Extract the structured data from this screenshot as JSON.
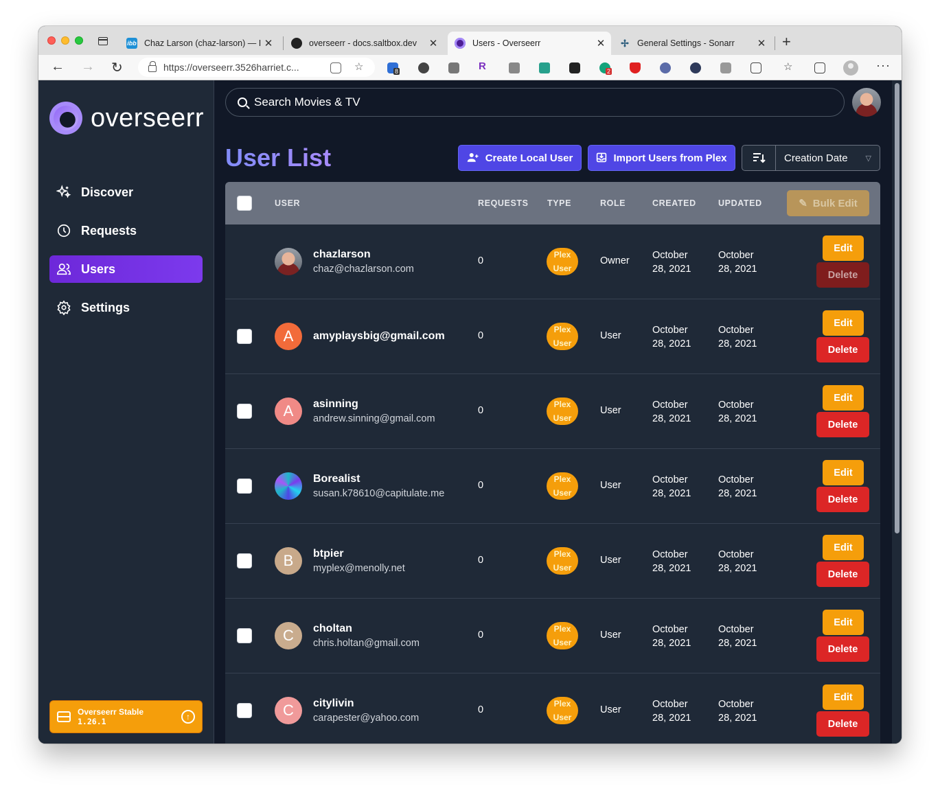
{
  "browser": {
    "tabs": [
      {
        "title": "Chaz Larson (chaz-larson) — I",
        "favicon": "ibb",
        "fav_color": "#1e90d6"
      },
      {
        "title": "overseerr - docs.saltbox.dev",
        "favicon": "github-icon",
        "fav_color": "#222222"
      },
      {
        "title": "Users - Overseerr",
        "favicon": "overseerr-icon",
        "fav_color": "#7c3aed",
        "active": true
      },
      {
        "title": "General Settings - Sonarr",
        "favicon": "sonarr-icon",
        "fav_color": "#2c5d7c"
      }
    ],
    "url": "https://overseerr.3526harriet.c...",
    "extension_badges": [
      "8",
      "2"
    ]
  },
  "app": {
    "logo_text": "overseerr",
    "nav": [
      {
        "label": "Discover",
        "icon": "sparkles-icon"
      },
      {
        "label": "Requests",
        "icon": "clock-icon"
      },
      {
        "label": "Users",
        "icon": "users-icon",
        "active": true
      },
      {
        "label": "Settings",
        "icon": "gear-icon"
      }
    ],
    "version": {
      "name": "Overseerr Stable",
      "number": "1.26.1"
    },
    "search_placeholder": "Search Movies & TV",
    "page_title": "User List",
    "buttons": {
      "create_local": "Create Local User",
      "import_plex": "Import Users from Plex",
      "sort_value": "Creation Date",
      "bulk_edit": "Bulk Edit",
      "edit": "Edit",
      "delete": "Delete"
    },
    "columns": [
      "USER",
      "REQUESTS",
      "TYPE",
      "ROLE",
      "CREATED",
      "UPDATED"
    ],
    "type_badge": [
      "Plex",
      "User"
    ],
    "users": [
      {
        "name": "chazlarson",
        "email": "chaz@chazlarson.com",
        "requests": "0",
        "role": "Owner",
        "created": [
          "October",
          "28, 2021"
        ],
        "updated": [
          "October",
          "28, 2021"
        ],
        "avatar": "photo",
        "avatar_color": "#8a5a4a",
        "selectable": false
      },
      {
        "name": "amyplaysbig@gmail.com",
        "email": "",
        "requests": "0",
        "role": "User",
        "created": [
          "October",
          "28, 2021"
        ],
        "updated": [
          "October",
          "28, 2021"
        ],
        "avatar": "A",
        "avatar_color": "#f26b3a",
        "selectable": true
      },
      {
        "name": "asinning",
        "email": "andrew.sinning@gmail.com",
        "requests": "0",
        "role": "User",
        "created": [
          "October",
          "28, 2021"
        ],
        "updated": [
          "October",
          "28, 2021"
        ],
        "avatar": "A",
        "avatar_color": "#f08a86",
        "selectable": true
      },
      {
        "name": "Borealist",
        "email": "susan.k78610@capitulate.me",
        "requests": "0",
        "role": "User",
        "created": [
          "October",
          "28, 2021"
        ],
        "updated": [
          "October",
          "28, 2021"
        ],
        "avatar": "pattern",
        "avatar_color": "#1fb8c9",
        "selectable": true
      },
      {
        "name": "btpier",
        "email": "myplex@menolly.net",
        "requests": "0",
        "role": "User",
        "created": [
          "October",
          "28, 2021"
        ],
        "updated": [
          "October",
          "28, 2021"
        ],
        "avatar": "B",
        "avatar_color": "#c8a98a",
        "selectable": true
      },
      {
        "name": "choltan",
        "email": "chris.holtan@gmail.com",
        "requests": "0",
        "role": "User",
        "created": [
          "October",
          "28, 2021"
        ],
        "updated": [
          "October",
          "28, 2021"
        ],
        "avatar": "C",
        "avatar_color": "#c9ac8e",
        "selectable": true
      },
      {
        "name": "citylivin",
        "email": "carapester@yahoo.com",
        "requests": "0",
        "role": "User",
        "created": [
          "October",
          "28, 2021"
        ],
        "updated": [
          "October",
          "28, 2021"
        ],
        "avatar": "C",
        "avatar_color": "#f09a9a",
        "selectable": true
      }
    ]
  }
}
